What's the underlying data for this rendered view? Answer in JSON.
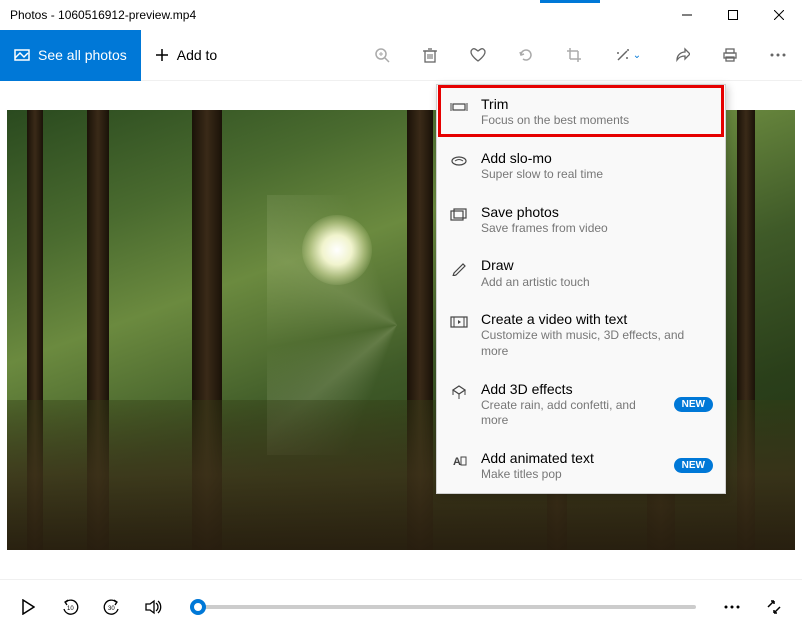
{
  "window": {
    "title": "Photos - 1060516912-preview.mp4"
  },
  "toolbar": {
    "see_all": "See all photos",
    "add_to": "Add to"
  },
  "dropdown": {
    "items": [
      {
        "label": "Trim",
        "sub": "Focus on the best moments"
      },
      {
        "label": "Add slo-mo",
        "sub": "Super slow to real time"
      },
      {
        "label": "Save photos",
        "sub": "Save frames from video"
      },
      {
        "label": "Draw",
        "sub": "Add an artistic touch"
      },
      {
        "label": "Create a video with text",
        "sub": "Customize with music, 3D effects, and more"
      },
      {
        "label": "Add 3D effects",
        "sub": "Create rain, add confetti, and more",
        "badge": "NEW"
      },
      {
        "label": "Add animated text",
        "sub": "Make titles pop",
        "badge": "NEW"
      }
    ]
  }
}
